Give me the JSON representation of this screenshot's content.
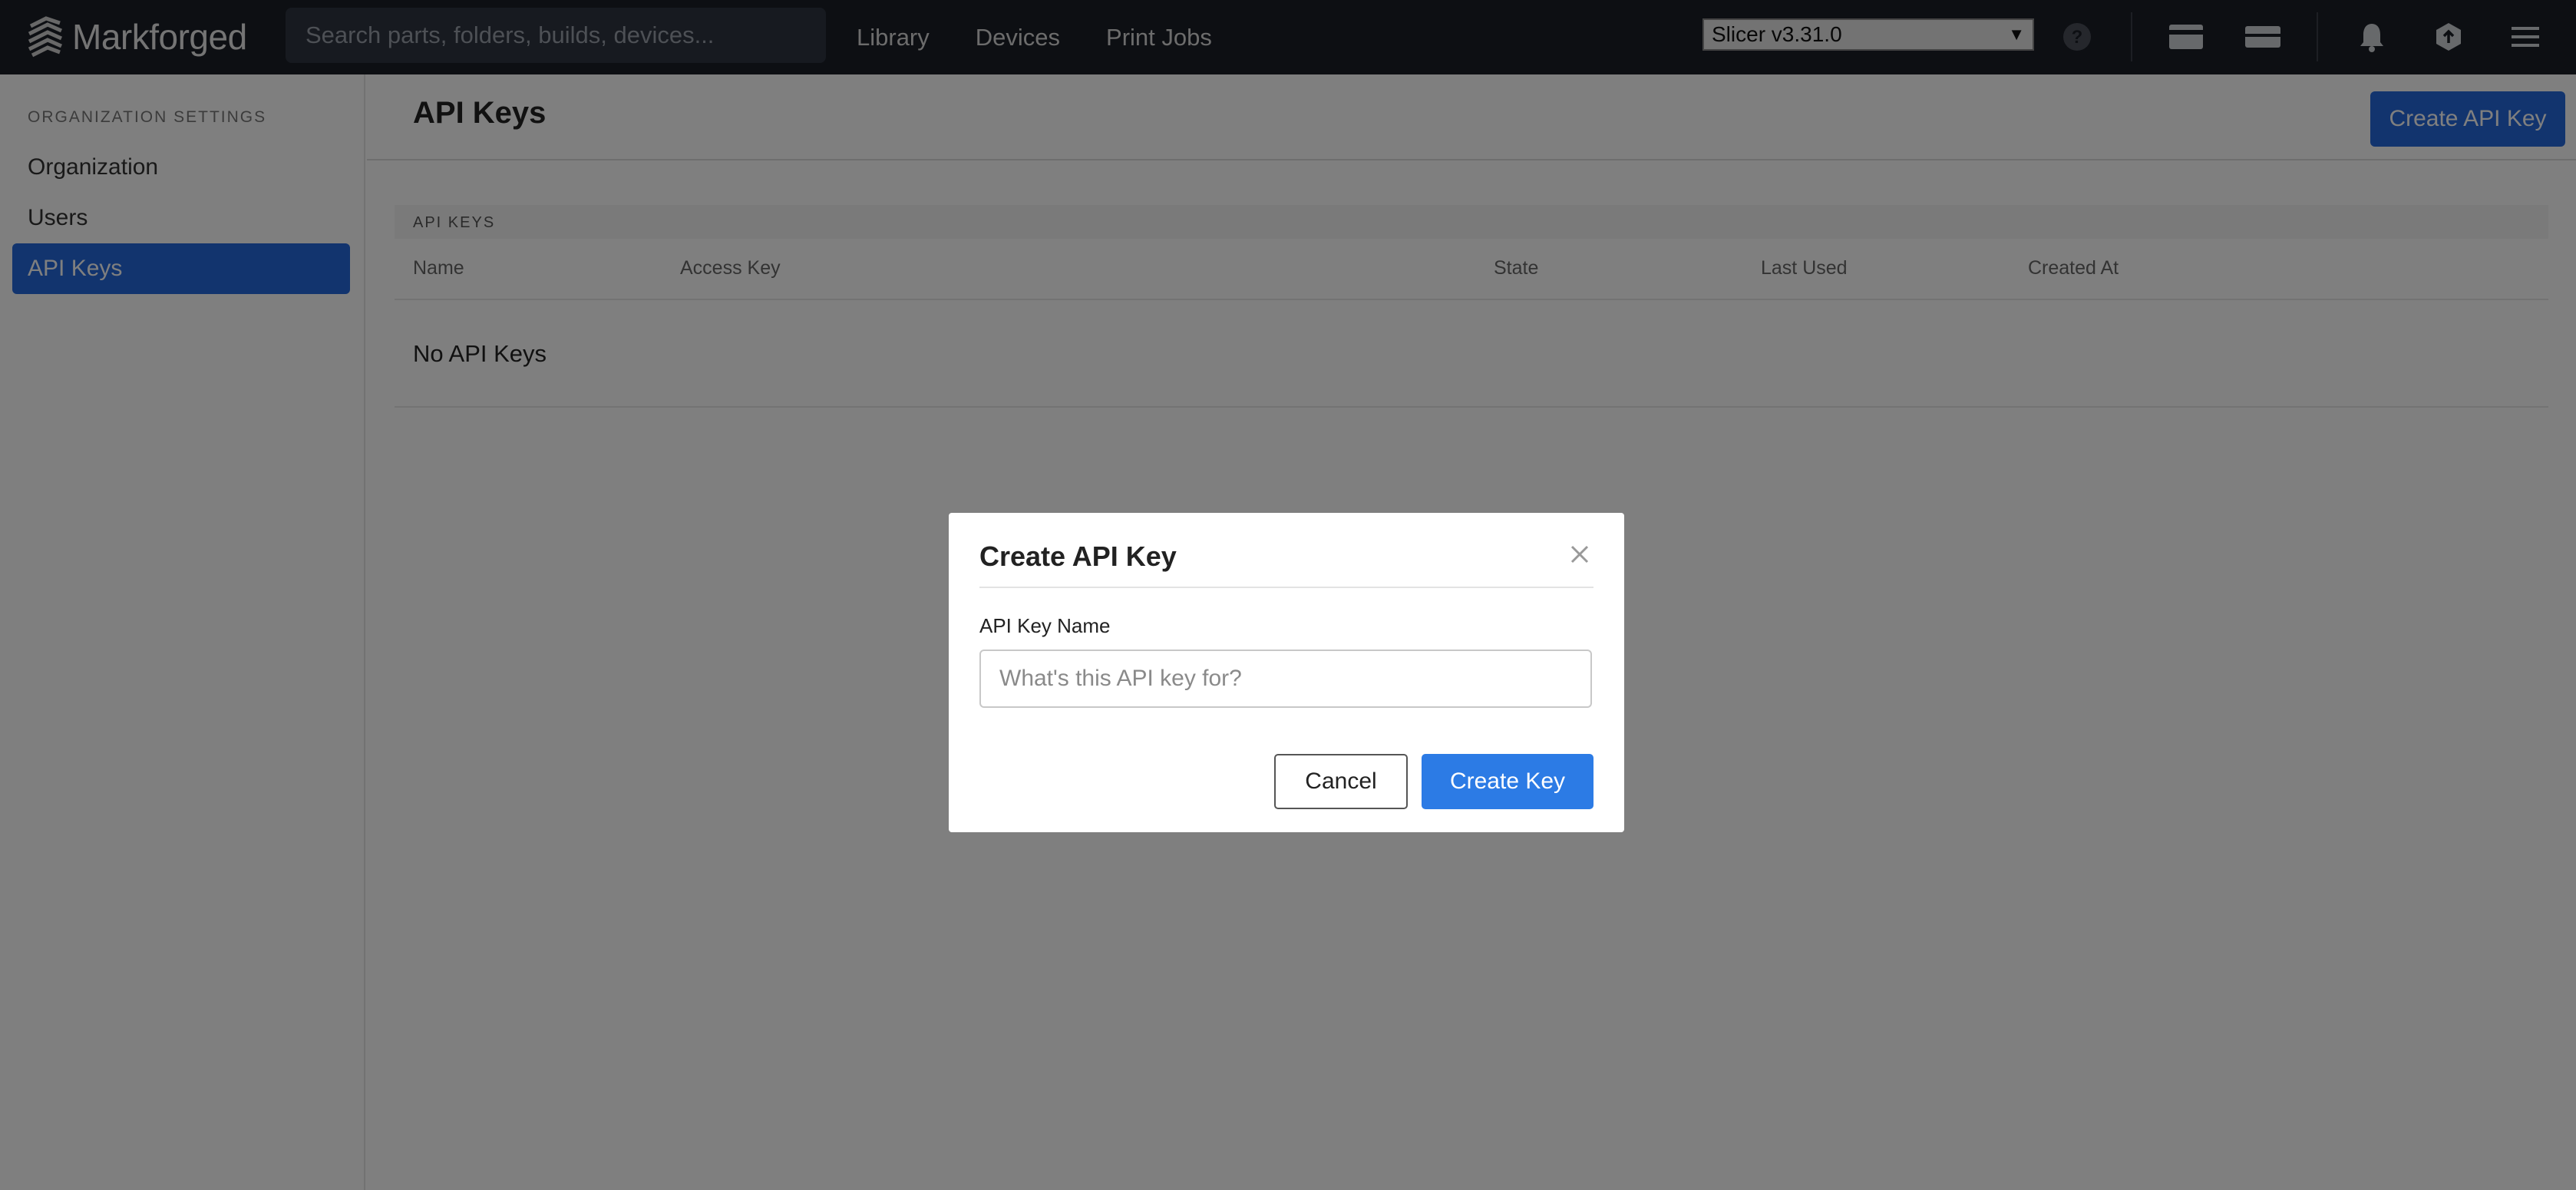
{
  "app": {
    "brand": "Markforged"
  },
  "search": {
    "placeholder": "Search parts, folders, builds, devices..."
  },
  "nav": {
    "items": [
      "Library",
      "Devices",
      "Print Jobs"
    ]
  },
  "slicer": {
    "selected": "Slicer v3.31.0"
  },
  "toolbar": {
    "icons": [
      "help-icon",
      "card-icon",
      "device-icon",
      "bell-icon",
      "upload-icon",
      "menu-icon"
    ]
  },
  "sidebar": {
    "heading": "ORGANIZATION SETTINGS",
    "items": [
      {
        "label": "Organization",
        "active": false
      },
      {
        "label": "Users",
        "active": false
      },
      {
        "label": "API Keys",
        "active": true
      }
    ]
  },
  "page": {
    "title": "API Keys",
    "create_button": "Create API Key",
    "section_label": "API KEYS",
    "columns": [
      "Name",
      "Access Key",
      "State",
      "Last Used",
      "Created At"
    ],
    "empty_message": "No API Keys"
  },
  "modal": {
    "title": "Create API Key",
    "field_label": "API Key Name",
    "field_placeholder": "What's this API key for?",
    "field_value": "",
    "cancel_label": "Cancel",
    "submit_label": "Create Key"
  },
  "colors": {
    "accent": "#2468dc",
    "topbar": "#1b1f27",
    "submit": "#2c7be5"
  }
}
